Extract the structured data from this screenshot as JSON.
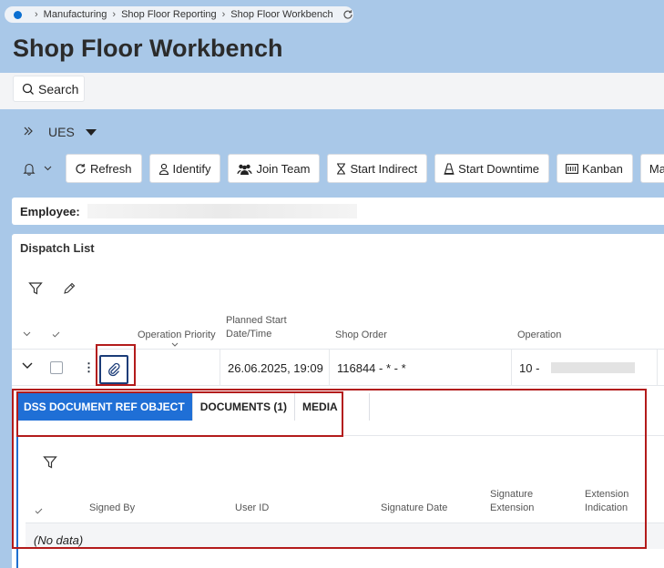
{
  "breadcrumb": {
    "items": [
      "Manufacturing",
      "Shop Floor Reporting",
      "Shop Floor Workbench"
    ]
  },
  "page": {
    "title": "Shop Floor Workbench"
  },
  "search": {
    "label": "Search"
  },
  "context": {
    "label": "UES"
  },
  "toolbar": {
    "buttons": [
      {
        "label": "Refresh",
        "icon": "refresh-icon"
      },
      {
        "label": "Identify",
        "icon": "person-icon"
      },
      {
        "label": "Join Team",
        "icon": "team-icon"
      },
      {
        "label": "Start Indirect",
        "icon": "hourglass-icon"
      },
      {
        "label": "Start Downtime",
        "icon": "cone-icon"
      },
      {
        "label": "Kanban",
        "icon": "kanban-icon"
      },
      {
        "label": "Manag",
        "icon": ""
      }
    ]
  },
  "employee": {
    "label": "Employee:"
  },
  "dispatch": {
    "title": "Dispatch List",
    "columns": {
      "priority": "Operation Priority",
      "planned_start_1": "Planned Start",
      "planned_start_2": "Date/Time",
      "shop_order": "Shop Order",
      "operation": "Operation"
    },
    "row": {
      "planned_start": "26.06.2025, 19:09",
      "shop_order": "116844 - * - *",
      "operation": "10 -"
    }
  },
  "subtabs": {
    "tabs": [
      "DSS DOCUMENT REF OBJECT",
      "DOCUMENTS (1)",
      "MEDIA"
    ],
    "active_index": 0,
    "columns": {
      "signed_by": "Signed By",
      "user_id": "User ID",
      "signature_date": "Signature Date",
      "sig_ext_1": "Signature",
      "sig_ext_2": "Extension",
      "ext_ind_1": "Extension",
      "ext_ind_2": "Indication"
    },
    "empty_text": "(No data)"
  },
  "colors": {
    "background": "#a9c8e8",
    "accent": "#1f6fd6",
    "highlight": "#b31b1b"
  }
}
